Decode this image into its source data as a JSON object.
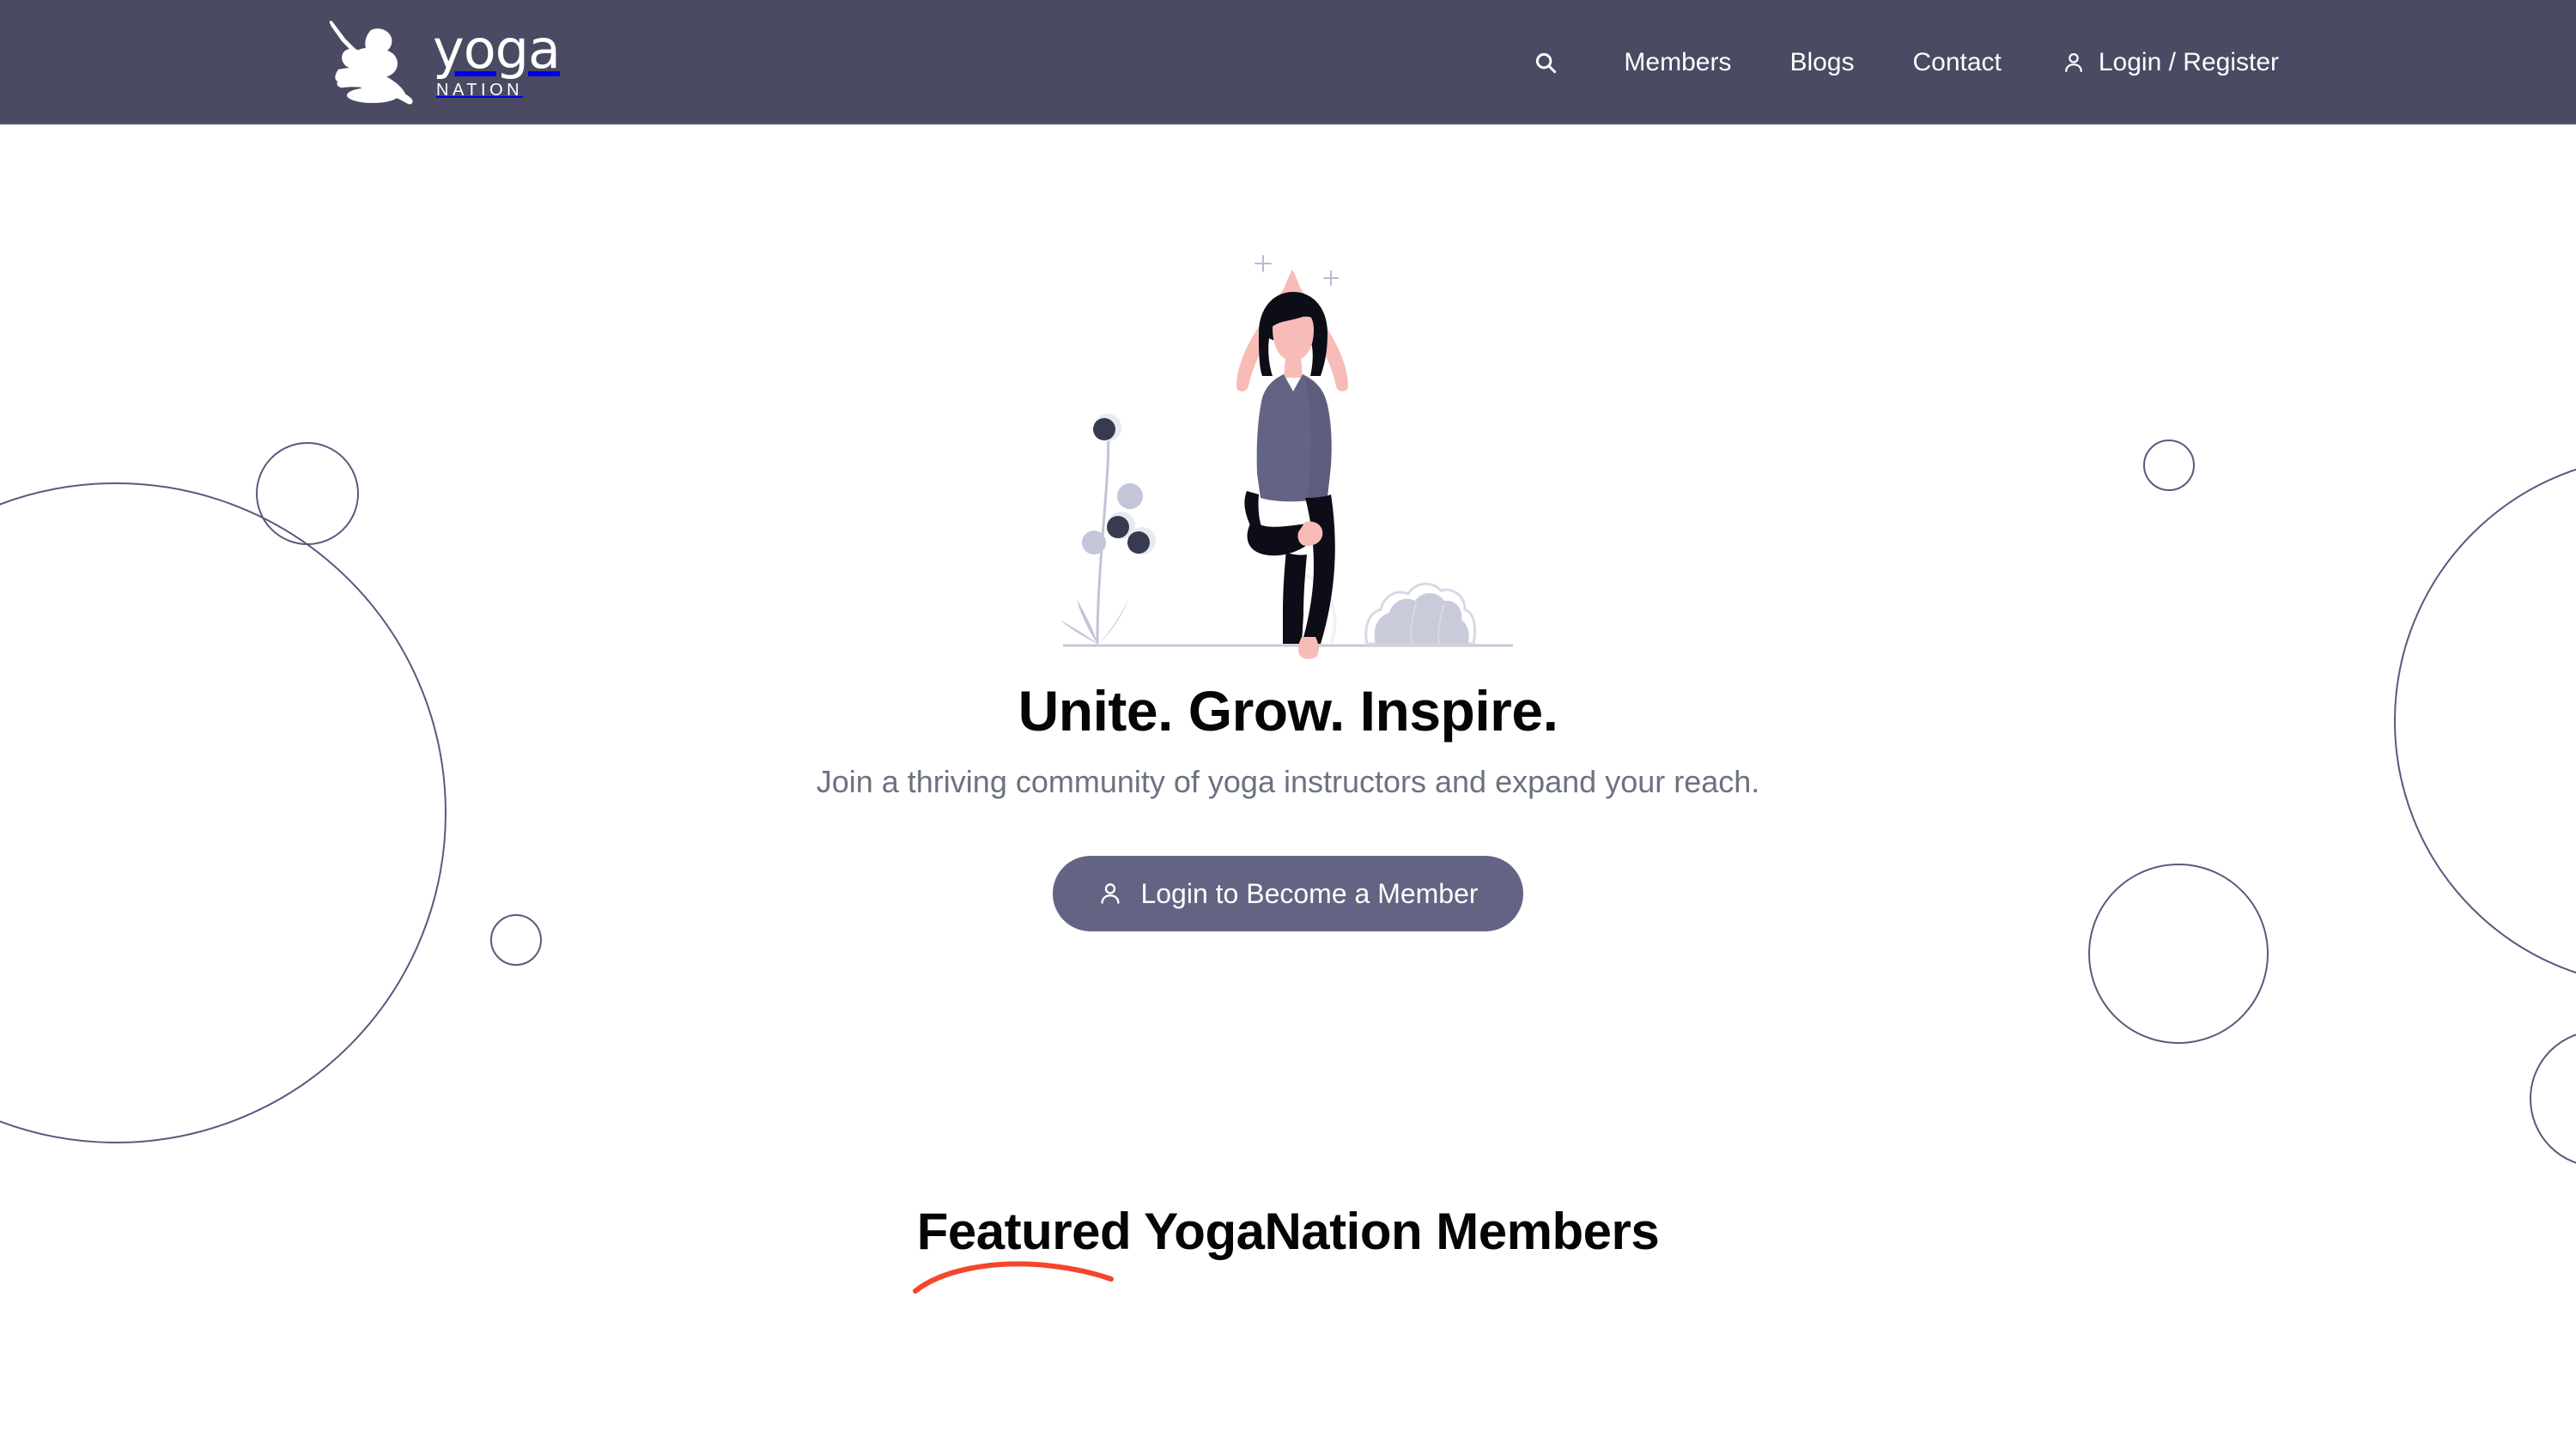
{
  "header": {
    "background_color": "#4a4a63",
    "brand": {
      "name": "yoga",
      "tagline": "NATION",
      "logo_icon": "yoga-figure-logo-icon"
    },
    "nav": {
      "search_icon": "search-icon",
      "items": [
        {
          "label": "Members"
        },
        {
          "label": "Blogs"
        },
        {
          "label": "Contact"
        }
      ],
      "login_register": {
        "label": "Login / Register",
        "icon": "user-icon"
      }
    }
  },
  "hero": {
    "illustration": "yoga-tree-pose-illustration",
    "title": "Unite. Grow. Inspire.",
    "subtitle": "Join a thriving community of yoga instructors and expand your reach.",
    "cta": {
      "label": "Login to Become a Member",
      "icon": "user-icon",
      "background_color": "#636383",
      "text_color": "#ffffff"
    }
  },
  "featured": {
    "heading": "Featured YogaNation Members",
    "underline_color": "#f4472a"
  },
  "decor": {
    "circle_stroke_color": "#585a7e"
  }
}
